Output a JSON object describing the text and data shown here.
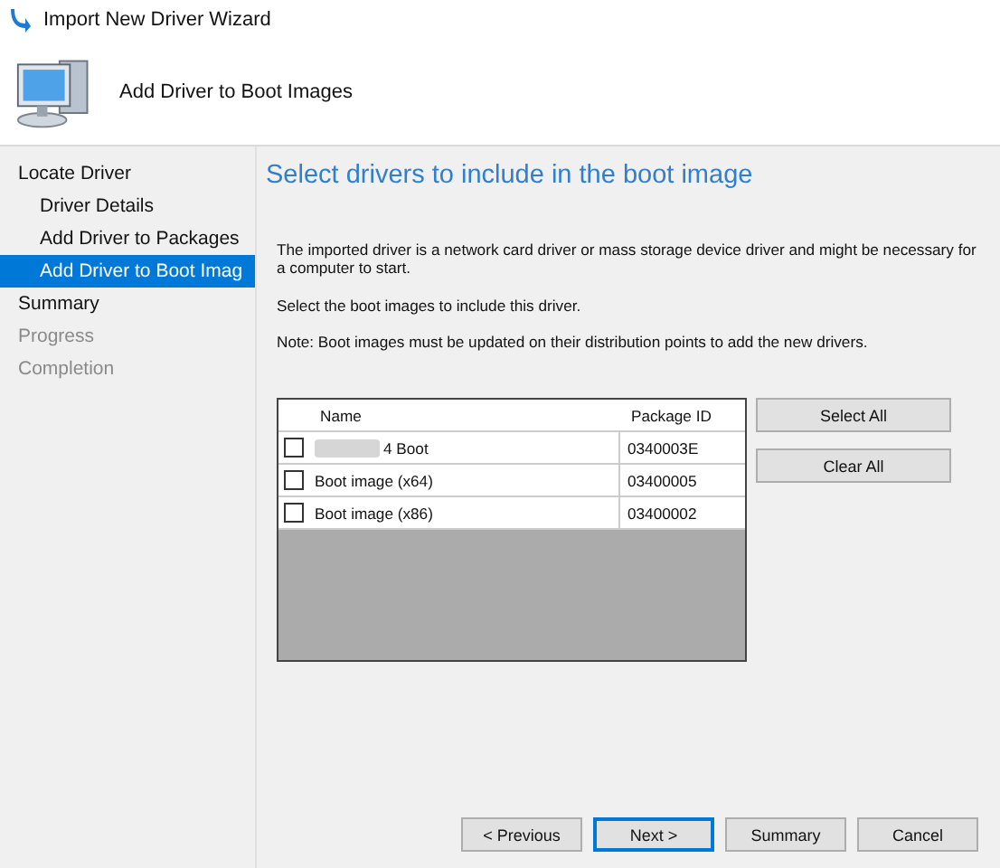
{
  "window": {
    "title": "Import New Driver Wizard"
  },
  "header": {
    "title": "Add Driver to Boot Images"
  },
  "sidebar": {
    "items": [
      {
        "label": "Locate Driver",
        "selected": false,
        "disabled": false,
        "children": [
          {
            "label": "Driver Details",
            "selected": false,
            "disabled": false
          },
          {
            "label": "Add Driver to Packages",
            "selected": false,
            "disabled": false
          },
          {
            "label": "Add Driver to Boot Imag",
            "selected": true,
            "disabled": false
          }
        ]
      },
      {
        "label": "Summary",
        "selected": false,
        "disabled": false
      },
      {
        "label": "Progress",
        "selected": false,
        "disabled": true
      },
      {
        "label": "Completion",
        "selected": false,
        "disabled": true
      }
    ]
  },
  "content": {
    "heading": "Select drivers to include in the boot image",
    "paragraphs": [
      "The imported driver is a network card driver or mass storage device driver and might be necessary for a computer to start.",
      "Select the boot images to include this driver.",
      "Note: Boot images must be updated on their distribution points to add the new drivers."
    ],
    "table": {
      "columns": [
        "Name",
        "Package ID"
      ],
      "rows": [
        {
          "name": "4 Boot",
          "redacted": true,
          "package_id": "0340003E",
          "checked": false
        },
        {
          "name": "Boot image (x64)",
          "redacted": false,
          "package_id": "03400005",
          "checked": false
        },
        {
          "name": "Boot image (x86)",
          "redacted": false,
          "package_id": "03400002",
          "checked": false
        }
      ]
    },
    "side_buttons": [
      "Select All",
      "Clear All"
    ]
  },
  "buttons": [
    {
      "label": "< Previous",
      "default": false
    },
    {
      "label": "Next >",
      "default": true
    },
    {
      "label": "Summary",
      "default": false
    },
    {
      "label": "Cancel",
      "default": false
    }
  ]
}
